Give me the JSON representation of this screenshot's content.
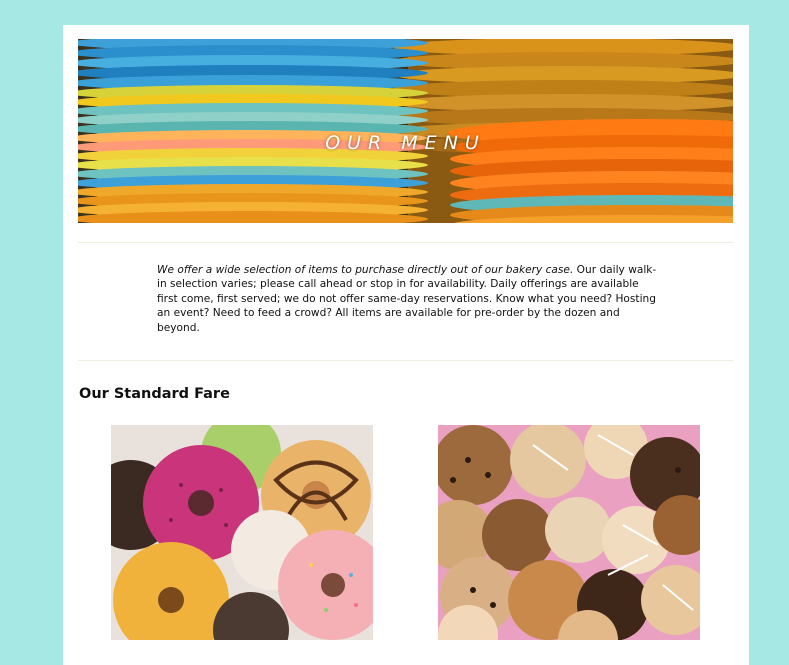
{
  "hero": {
    "title": "OUR MENU"
  },
  "intro": {
    "lead": "We offer a wide selection of items to purchase directly out of our bakery case.",
    "body": " Our daily walk-in selection varies; please call ahead or stop in for availability. Daily offerings are available first come, first served; we do not offer same-day reservations. Know what you need? Hosting an event? Need to feed a crowd? All items are available for pre-order by the dozen and beyond."
  },
  "section": {
    "title": "Our Standard Fare"
  },
  "colors": {
    "page_background": "#a6e8e4",
    "card_background": "#ffffff",
    "rule": "#efeedd"
  },
  "images": [
    {
      "subject": "donuts-photo"
    },
    {
      "subject": "cookies-photo"
    }
  ]
}
